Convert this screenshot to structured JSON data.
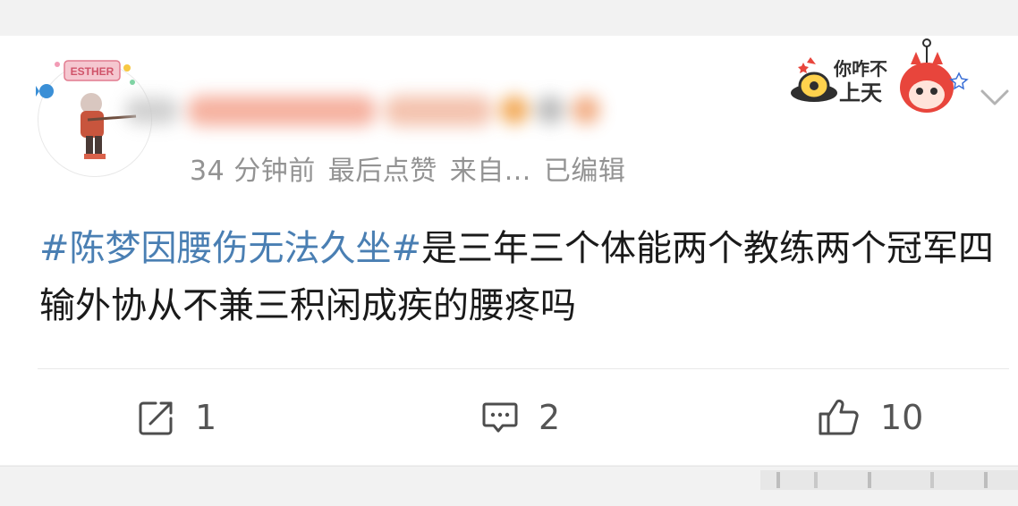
{
  "post": {
    "meta": {
      "time": "34 分钟前",
      "reason": "最后点赞",
      "source": "来自...",
      "edited": "已编辑"
    },
    "content": {
      "hashtag": "#陈梦因腰伤无法久坐#",
      "text": "是三年三个体能两个教练两个冠军四输外协从不兼三积闲成疾的腰疼吗"
    },
    "actions": {
      "repost_count": "1",
      "comment_count": "2",
      "like_count": "10"
    },
    "avatar_badge_text": "ESTHER",
    "sticker_text_line1": "你咋不",
    "sticker_text_line2": "上天"
  },
  "icons": {
    "repost": "repost-icon",
    "comment": "comment-icon",
    "like": "thumbs-up-icon",
    "menu": "chevron-down-icon"
  },
  "colors": {
    "hashtag": "#4a7fb3",
    "meta_text": "#939393",
    "sticker_red": "#e8453c"
  }
}
